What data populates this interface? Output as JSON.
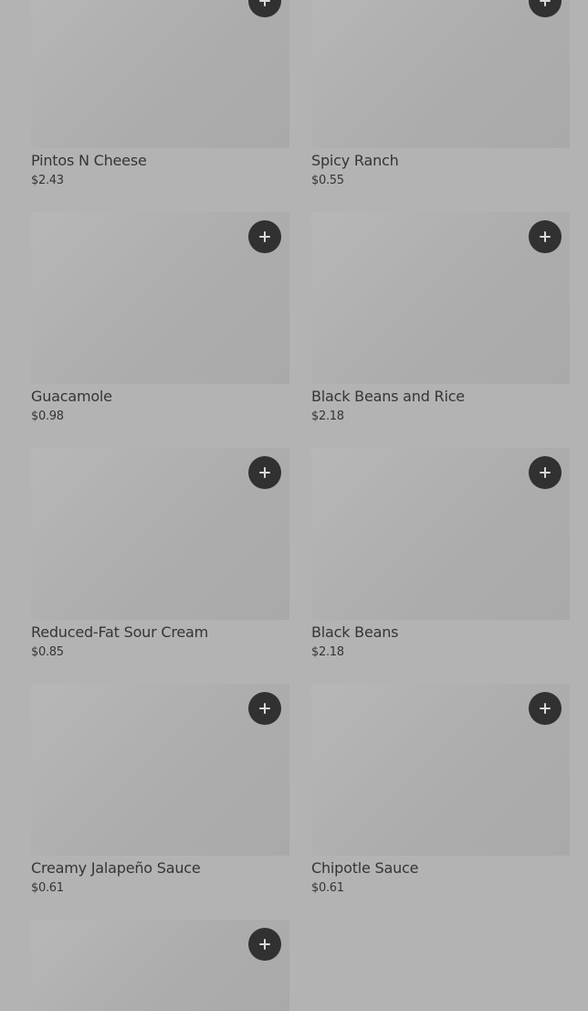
{
  "menu": {
    "items": [
      {
        "name": "",
        "price": "",
        "add_label": "+"
      },
      {
        "name": "",
        "price": "",
        "add_label": "+"
      },
      {
        "name": "Pintos N Cheese",
        "price": "$2.43",
        "add_label": "+"
      },
      {
        "name": "Spicy Ranch",
        "price": "$0.55",
        "add_label": "+"
      },
      {
        "name": "Guacamole",
        "price": "$0.98",
        "add_label": "+"
      },
      {
        "name": "Black Beans and Rice",
        "price": "$2.18",
        "add_label": "+"
      },
      {
        "name": "Reduced-Fat Sour Cream",
        "price": "$0.85",
        "add_label": "+"
      },
      {
        "name": "Black Beans",
        "price": "$2.18",
        "add_label": "+"
      },
      {
        "name": "Creamy Jalapeño Sauce",
        "price": "$0.61",
        "add_label": "+"
      },
      {
        "name": "Chipotle Sauce",
        "price": "$0.61",
        "add_label": "+"
      },
      {
        "name": "",
        "price": "",
        "add_label": "+"
      }
    ]
  },
  "colors": {
    "background": "#b3b3b3",
    "thumbnail": "#b0b0b0",
    "add_button": "#313131",
    "text": "#353535"
  },
  "icons": {
    "add": "plus-icon"
  }
}
